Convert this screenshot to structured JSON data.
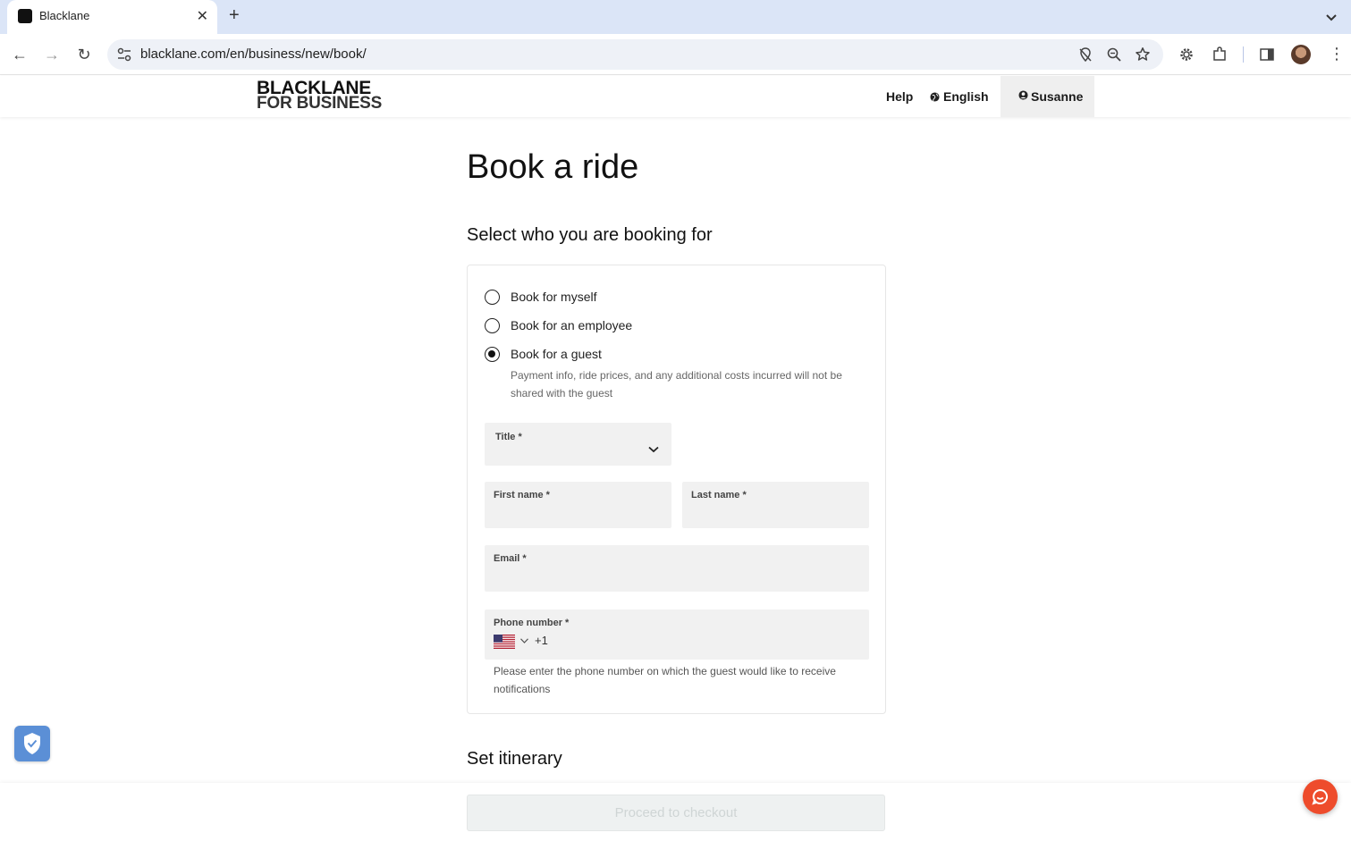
{
  "browser": {
    "tab_title": "Blacklane",
    "url": "blacklane.com/en/business/new/book/"
  },
  "header": {
    "logo_line1": "BLACKLANE",
    "logo_line2": "FOR BUSINESS",
    "help": "Help",
    "language": "English",
    "user": "Susanne"
  },
  "main": {
    "title": "Book a ride",
    "booking_section": {
      "heading": "Select who you are booking for",
      "options": [
        {
          "label": "Book for myself",
          "checked": false
        },
        {
          "label": "Book for an employee",
          "checked": false
        },
        {
          "label": "Book for a guest",
          "checked": true
        }
      ],
      "guest_hint": "Payment info, ride prices, and any additional costs incurred will not be shared with the guest",
      "fields": {
        "title_label": "Title *",
        "first_name_label": "First name *",
        "last_name_label": "Last name *",
        "email_label": "Email *",
        "phone_label": "Phone number *",
        "phone_dial_code": "+1",
        "phone_hint": "Please enter the phone number on which the guest would like to receive notifications"
      }
    },
    "itinerary_heading": "Set itinerary"
  },
  "footer": {
    "checkout_label": "Proceed to checkout"
  },
  "colors": {
    "chat_accent": "#ee4c2c",
    "shield_badge": "#5b8fd6",
    "tab_strip": "#dbe5f7"
  }
}
